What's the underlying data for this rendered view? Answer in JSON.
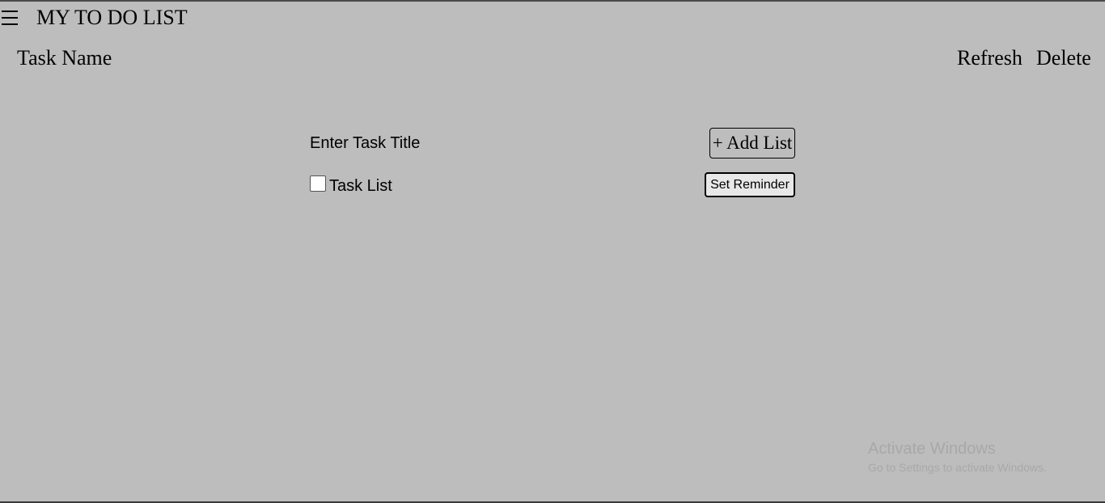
{
  "header": {
    "menu_icon": "hamburger-menu-icon",
    "app_title": "MY TO DO LIST",
    "column_label": "Task Name",
    "refresh_label": "Refresh",
    "delete_label": "Delete"
  },
  "form": {
    "task_title_label": "Enter Task Title",
    "add_list_label": "+ Add List",
    "task_list_label": "Task List",
    "task_list_checked": false,
    "set_reminder_label": "Set Reminder"
  },
  "watermark": {
    "title": "Activate Windows",
    "subtitle": "Go to Settings to activate Windows."
  },
  "colors": {
    "background": "#bdbdbd",
    "text": "#000000",
    "watermark": "#a8a8a8"
  }
}
